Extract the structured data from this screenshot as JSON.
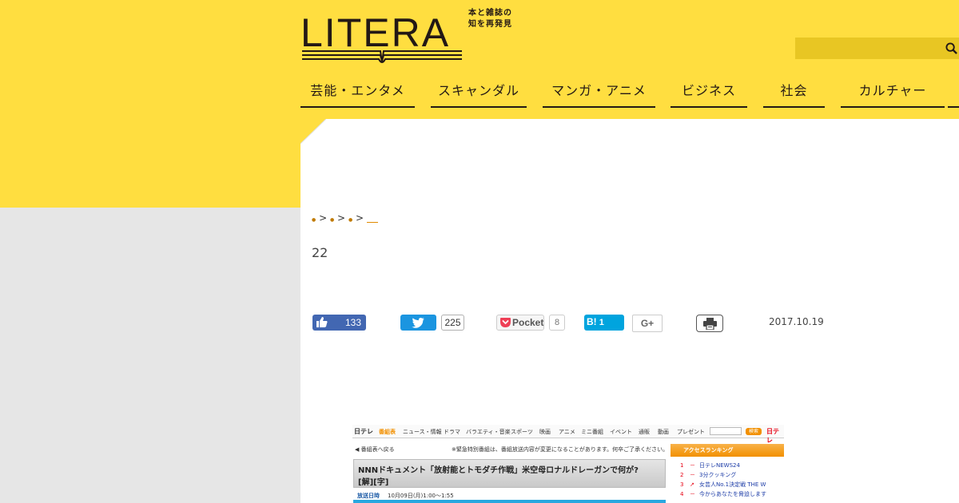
{
  "colors": {
    "brand_yellow": "#ffde40",
    "nav_underline": "#231815",
    "facebook": "#4267b2",
    "twitter": "#1b95e0",
    "hatena": "#00a4de",
    "page_gray": "#e6e6e6"
  },
  "header": {
    "logo_text": "LITERA",
    "logo_tagline_1": "本と雑誌の",
    "logo_tagline_2": "知を再発見",
    "search_icon": "search-icon"
  },
  "nav": {
    "items": [
      {
        "label": "芸能・エンタメ"
      },
      {
        "label": "スキャンダル"
      },
      {
        "label": "マンガ・アニメ"
      },
      {
        "label": "ビジネス"
      },
      {
        "label": "社会"
      },
      {
        "label": "カルチャー"
      }
    ]
  },
  "article": {
    "breadcrumb_sep": ">",
    "title": "22",
    "date": "2017.10.19",
    "share": {
      "facebook_count": "133",
      "twitter_count": "225",
      "pocket_label": "Pocket",
      "pocket_count": "8",
      "hatena_label": "B!",
      "hatena_count": "1",
      "gplus_label": "G+"
    }
  },
  "embedded_screenshot": {
    "logo": "日テレ",
    "nav": [
      "番組表",
      "ニュース・情報",
      "ドラマ",
      "バラエティ・音楽",
      "スポーツ",
      "映画",
      "アニメ",
      "ミニ番組",
      "イベント",
      "通販",
      "動画",
      "プレゼント"
    ],
    "search_button": "検索",
    "corner_logo": "日テレ",
    "back_link": "番組表へ戻る",
    "notice": "※緊急特別番組は、番組放送内容が変更になることがあります。何卒ご了承ください。",
    "program_title": "NNNドキュメント「放射能とトモダチ作戦」米空母ロナルドレーガンで何が?",
    "program_tags": "[解][字]",
    "broadcast_label": "放送日時",
    "broadcast_time": "10月09日(月)1:00〜1:55",
    "ranking_title": "アクセスランキング",
    "ranking": [
      {
        "n": "1",
        "arrow": "－",
        "title": "日テレNEWS24"
      },
      {
        "n": "2",
        "arrow": "－",
        "title": "3分クッキング"
      },
      {
        "n": "3",
        "arrow": "↗",
        "title": "女芸人No.1決定戦 THE W"
      },
      {
        "n": "4",
        "arrow": "－",
        "title": "今からあなたを脅迫します"
      }
    ]
  }
}
